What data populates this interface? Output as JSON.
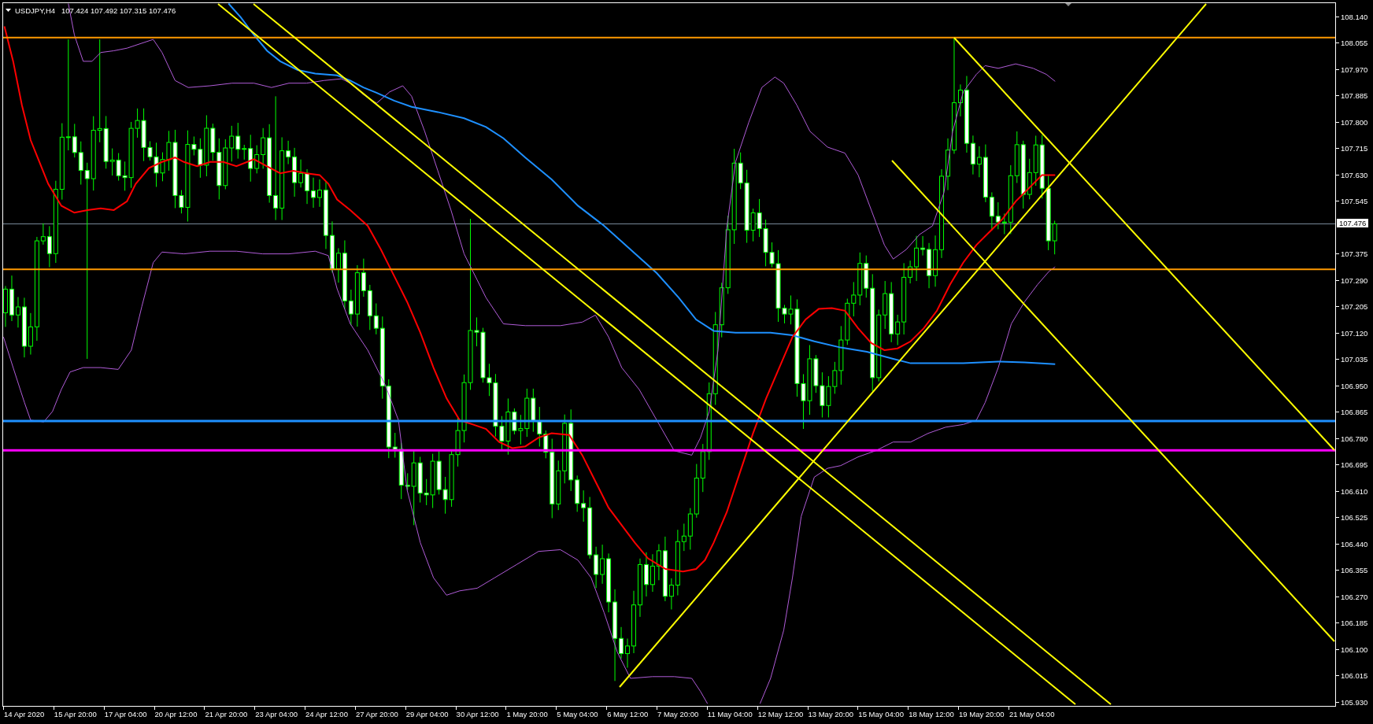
{
  "chart": {
    "header": {
      "symbol": "USDJPY,H4",
      "ohlc": "107.424 107.492 107.315 107.476"
    },
    "price_axis": {
      "labels_above": [
        "108.140",
        "108.055",
        "107.970",
        "107.885",
        "107.800",
        "107.715",
        "107.630",
        "107.545"
      ],
      "current_price": "107.476",
      "labels_below": [
        "107.375",
        "107.290",
        "107.205",
        "107.120",
        "107.035",
        "106.950",
        "106.865",
        "106.780",
        "106.695",
        "106.610",
        "106.525",
        "106.440",
        "106.355",
        "106.270",
        "106.185",
        "106.100",
        "106.015",
        "105.930"
      ]
    },
    "time_axis": {
      "labels": [
        "14 Apr 2020",
        "15 Apr 20:00",
        "17 Apr 04:00",
        "20 Apr 12:00",
        "21 Apr 20:00",
        "23 Apr 04:00",
        "24 Apr 12:00",
        "27 Apr 20:00",
        "29 Apr 04:00",
        "30 Apr 12:00",
        "1 May 20:00",
        "5 May 04:00",
        "6 May 12:00",
        "7 May 20:00",
        "11 May 04:00",
        "12 May 12:00",
        "13 May 20:00",
        "15 May 04:00",
        "18 May 12:00",
        "19 May 20:00",
        "21 May 04:00"
      ]
    }
  }
}
